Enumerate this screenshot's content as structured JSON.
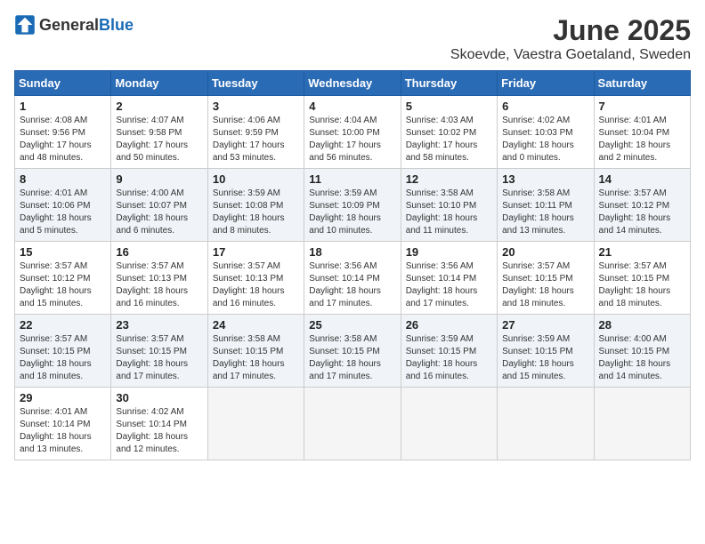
{
  "header": {
    "logo_general": "General",
    "logo_blue": "Blue",
    "title": "June 2025",
    "subtitle": "Skoevde, Vaestra Goetaland, Sweden"
  },
  "days_of_week": [
    "Sunday",
    "Monday",
    "Tuesday",
    "Wednesday",
    "Thursday",
    "Friday",
    "Saturday"
  ],
  "weeks": [
    [
      {
        "day": "1",
        "sunrise": "4:08 AM",
        "sunset": "9:56 PM",
        "daylight": "17 hours and 48 minutes."
      },
      {
        "day": "2",
        "sunrise": "4:07 AM",
        "sunset": "9:58 PM",
        "daylight": "17 hours and 50 minutes."
      },
      {
        "day": "3",
        "sunrise": "4:06 AM",
        "sunset": "9:59 PM",
        "daylight": "17 hours and 53 minutes."
      },
      {
        "day": "4",
        "sunrise": "4:04 AM",
        "sunset": "10:00 PM",
        "daylight": "17 hours and 56 minutes."
      },
      {
        "day": "5",
        "sunrise": "4:03 AM",
        "sunset": "10:02 PM",
        "daylight": "17 hours and 58 minutes."
      },
      {
        "day": "6",
        "sunrise": "4:02 AM",
        "sunset": "10:03 PM",
        "daylight": "18 hours and 0 minutes."
      },
      {
        "day": "7",
        "sunrise": "4:01 AM",
        "sunset": "10:04 PM",
        "daylight": "18 hours and 2 minutes."
      }
    ],
    [
      {
        "day": "8",
        "sunrise": "4:01 AM",
        "sunset": "10:06 PM",
        "daylight": "18 hours and 5 minutes."
      },
      {
        "day": "9",
        "sunrise": "4:00 AM",
        "sunset": "10:07 PM",
        "daylight": "18 hours and 6 minutes."
      },
      {
        "day": "10",
        "sunrise": "3:59 AM",
        "sunset": "10:08 PM",
        "daylight": "18 hours and 8 minutes."
      },
      {
        "day": "11",
        "sunrise": "3:59 AM",
        "sunset": "10:09 PM",
        "daylight": "18 hours and 10 minutes."
      },
      {
        "day": "12",
        "sunrise": "3:58 AM",
        "sunset": "10:10 PM",
        "daylight": "18 hours and 11 minutes."
      },
      {
        "day": "13",
        "sunrise": "3:58 AM",
        "sunset": "10:11 PM",
        "daylight": "18 hours and 13 minutes."
      },
      {
        "day": "14",
        "sunrise": "3:57 AM",
        "sunset": "10:12 PM",
        "daylight": "18 hours and 14 minutes."
      }
    ],
    [
      {
        "day": "15",
        "sunrise": "3:57 AM",
        "sunset": "10:12 PM",
        "daylight": "18 hours and 15 minutes."
      },
      {
        "day": "16",
        "sunrise": "3:57 AM",
        "sunset": "10:13 PM",
        "daylight": "18 hours and 16 minutes."
      },
      {
        "day": "17",
        "sunrise": "3:57 AM",
        "sunset": "10:13 PM",
        "daylight": "18 hours and 16 minutes."
      },
      {
        "day": "18",
        "sunrise": "3:56 AM",
        "sunset": "10:14 PM",
        "daylight": "18 hours and 17 minutes."
      },
      {
        "day": "19",
        "sunrise": "3:56 AM",
        "sunset": "10:14 PM",
        "daylight": "18 hours and 17 minutes."
      },
      {
        "day": "20",
        "sunrise": "3:57 AM",
        "sunset": "10:15 PM",
        "daylight": "18 hours and 18 minutes."
      },
      {
        "day": "21",
        "sunrise": "3:57 AM",
        "sunset": "10:15 PM",
        "daylight": "18 hours and 18 minutes."
      }
    ],
    [
      {
        "day": "22",
        "sunrise": "3:57 AM",
        "sunset": "10:15 PM",
        "daylight": "18 hours and 18 minutes."
      },
      {
        "day": "23",
        "sunrise": "3:57 AM",
        "sunset": "10:15 PM",
        "daylight": "18 hours and 17 minutes."
      },
      {
        "day": "24",
        "sunrise": "3:58 AM",
        "sunset": "10:15 PM",
        "daylight": "18 hours and 17 minutes."
      },
      {
        "day": "25",
        "sunrise": "3:58 AM",
        "sunset": "10:15 PM",
        "daylight": "18 hours and 17 minutes."
      },
      {
        "day": "26",
        "sunrise": "3:59 AM",
        "sunset": "10:15 PM",
        "daylight": "18 hours and 16 minutes."
      },
      {
        "day": "27",
        "sunrise": "3:59 AM",
        "sunset": "10:15 PM",
        "daylight": "18 hours and 15 minutes."
      },
      {
        "day": "28",
        "sunrise": "4:00 AM",
        "sunset": "10:15 PM",
        "daylight": "18 hours and 14 minutes."
      }
    ],
    [
      {
        "day": "29",
        "sunrise": "4:01 AM",
        "sunset": "10:14 PM",
        "daylight": "18 hours and 13 minutes."
      },
      {
        "day": "30",
        "sunrise": "4:02 AM",
        "sunset": "10:14 PM",
        "daylight": "18 hours and 12 minutes."
      },
      null,
      null,
      null,
      null,
      null
    ]
  ],
  "labels": {
    "sunrise": "Sunrise:",
    "sunset": "Sunset:",
    "daylight": "Daylight:"
  }
}
